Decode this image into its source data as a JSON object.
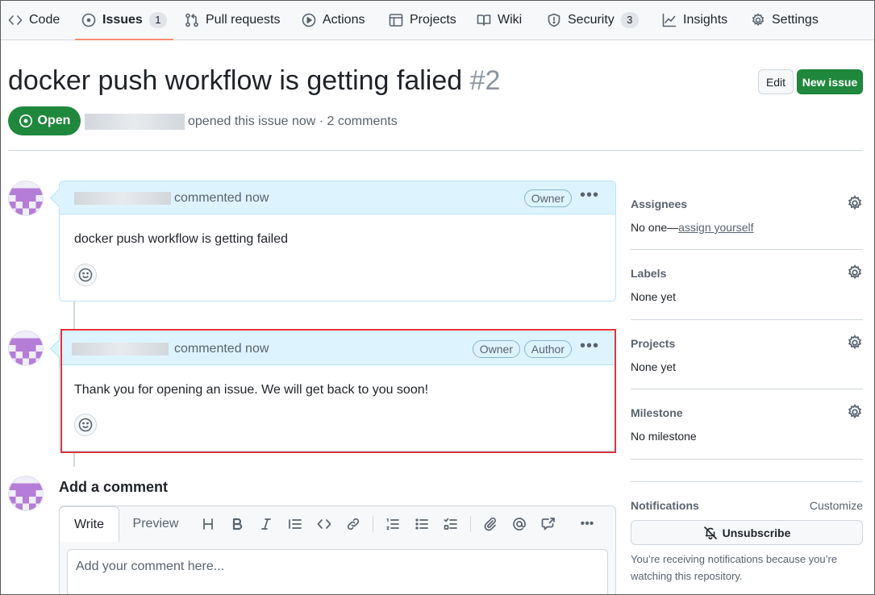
{
  "nav": {
    "tabs": [
      {
        "label": "Code",
        "icon": "code-icon"
      },
      {
        "label": "Issues",
        "icon": "issue-opened-icon",
        "count": "1",
        "active": true
      },
      {
        "label": "Pull requests",
        "icon": "git-pull-request-icon"
      },
      {
        "label": "Actions",
        "icon": "play-icon"
      },
      {
        "label": "Projects",
        "icon": "table-icon"
      },
      {
        "label": "Wiki",
        "icon": "book-icon"
      },
      {
        "label": "Security",
        "icon": "shield-icon",
        "count": "3"
      },
      {
        "label": "Insights",
        "icon": "graph-icon"
      },
      {
        "label": "Settings",
        "icon": "gear-icon"
      }
    ]
  },
  "issue": {
    "title": "docker push workflow is getting falied",
    "number": "#2",
    "state": "Open",
    "meta": "opened this issue now · 2 comments",
    "edit_label": "Edit",
    "new_issue_label": "New issue"
  },
  "comments": [
    {
      "verb": "commented now",
      "badges": [
        "Owner"
      ],
      "body": "docker push workflow is getting failed"
    },
    {
      "verb": "commented now",
      "badges": [
        "Owner",
        "Author"
      ],
      "body": "Thank you for opening an issue. We will get back to you soon!"
    }
  ],
  "add_comment": {
    "title": "Add a comment",
    "tab_write": "Write",
    "tab_preview": "Preview",
    "placeholder": "Add your comment here..."
  },
  "sidebar": {
    "assignees": {
      "heading": "Assignees",
      "value_prefix": "No one—",
      "link": "assign yourself"
    },
    "labels": {
      "heading": "Labels",
      "value": "None yet"
    },
    "projects": {
      "heading": "Projects",
      "value": "None yet"
    },
    "milestone": {
      "heading": "Milestone",
      "value": "No milestone"
    },
    "notifications": {
      "heading": "Notifications",
      "customize": "Customize",
      "button": "Unsubscribe",
      "note": "You’re receiving notifications because you’re watching this repository."
    }
  },
  "colors": {
    "accent_green": "#1f883d",
    "comment_header": "#ddf4ff",
    "highlight_border": "#e2323c",
    "active_tab_underline": "#fd8c73"
  }
}
